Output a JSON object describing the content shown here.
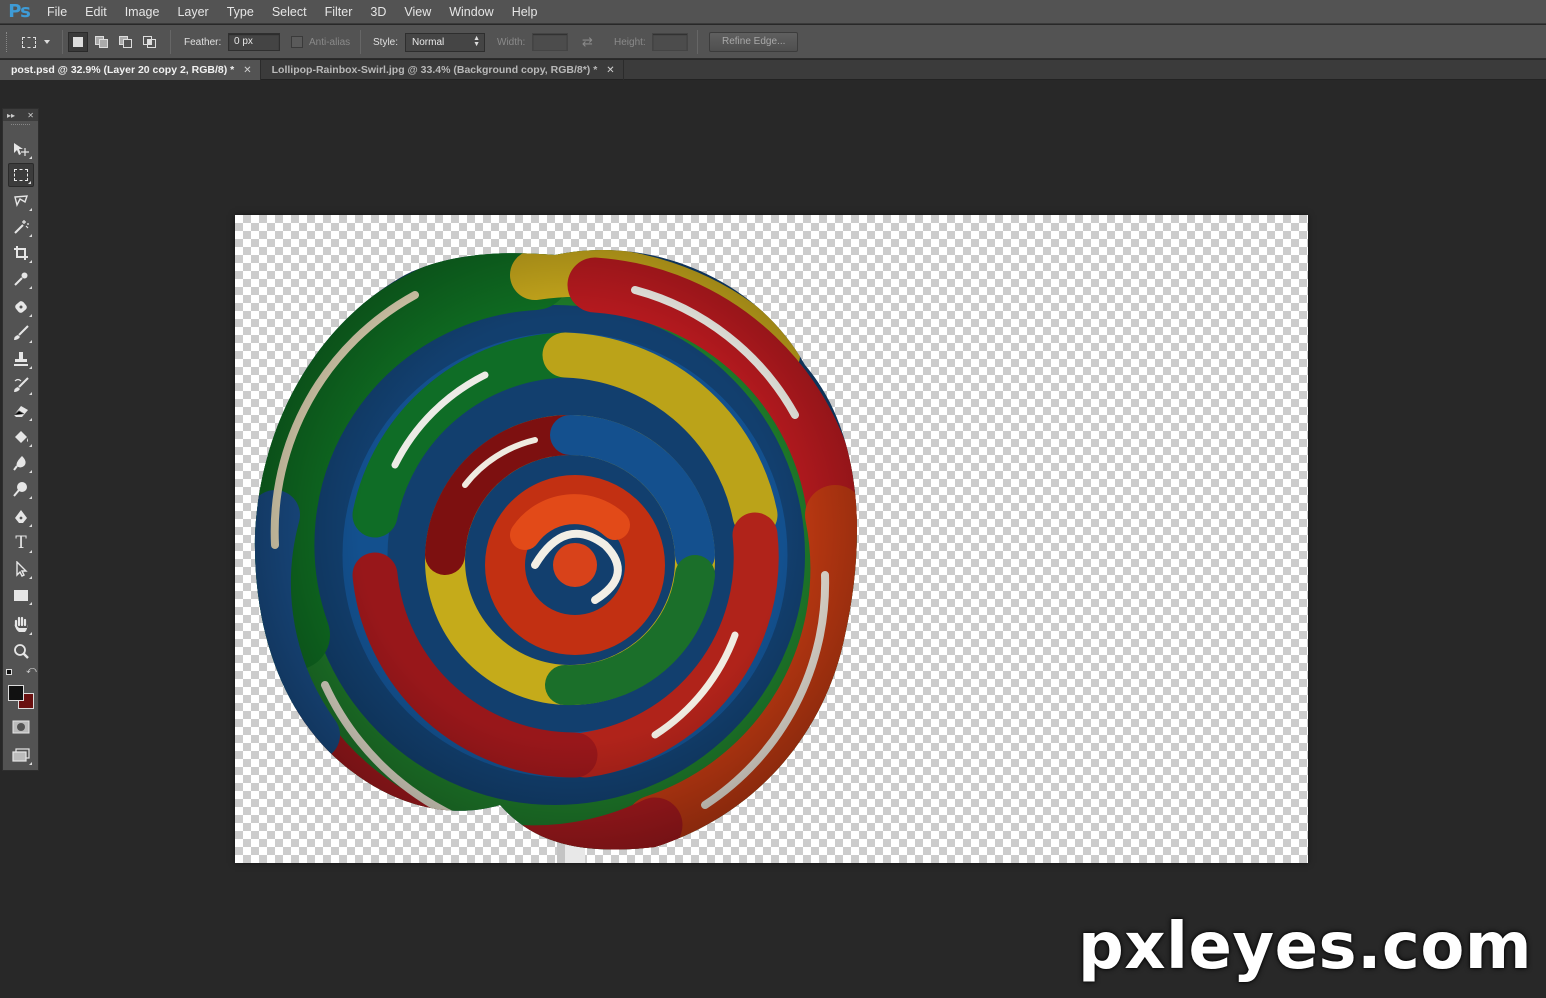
{
  "app": {
    "logo": "Ps",
    "menu": [
      "File",
      "Edit",
      "Image",
      "Layer",
      "Type",
      "Select",
      "Filter",
      "3D",
      "View",
      "Window",
      "Help"
    ]
  },
  "options_bar": {
    "tool_icon": "rectangular-marquee-icon",
    "selection_modes": [
      "new-selection-icon",
      "add-to-selection-icon",
      "subtract-from-selection-icon",
      "intersect-selection-icon"
    ],
    "feather_label": "Feather:",
    "feather_value": "0 px",
    "antialias_label": "Anti-alias",
    "antialias_checked": false,
    "style_label": "Style:",
    "style_value": "Normal",
    "width_label": "Width:",
    "width_value": "",
    "swap_icon": "swap-arrows-icon",
    "height_label": "Height:",
    "height_value": "",
    "refine_edge_label": "Refine Edge..."
  },
  "tabs": [
    {
      "title": "post.psd @ 32.9% (Layer 20 copy 2, RGB/8) *",
      "active": true
    },
    {
      "title": "Lollipop-Rainbox-Swirl.jpg @ 33.4% (Background copy, RGB/8*) *",
      "active": false
    }
  ],
  "tools": [
    "move-tool-icon",
    "rectangular-marquee-tool-icon",
    "lasso-tool-icon",
    "magic-wand-tool-icon",
    "crop-tool-icon",
    "eyedropper-tool-icon",
    "spot-healing-brush-icon",
    "brush-tool-icon",
    "clone-stamp-icon",
    "history-brush-icon",
    "eraser-tool-icon",
    "paint-bucket-icon",
    "blur-tool-icon",
    "dodge-tool-icon",
    "pen-tool-icon",
    "type-tool-icon",
    "path-selection-icon",
    "rectangle-tool-icon",
    "hand-tool-icon",
    "zoom-tool-icon"
  ],
  "colors": {
    "foreground": "#111111",
    "background": "#6a1010",
    "ui_panel": "#535353",
    "workspace": "#282828"
  },
  "canvas": {
    "content": "rainbow-swirl-lollipop-image",
    "transparency": "checkerboard"
  },
  "watermark": "pxleyes.com"
}
